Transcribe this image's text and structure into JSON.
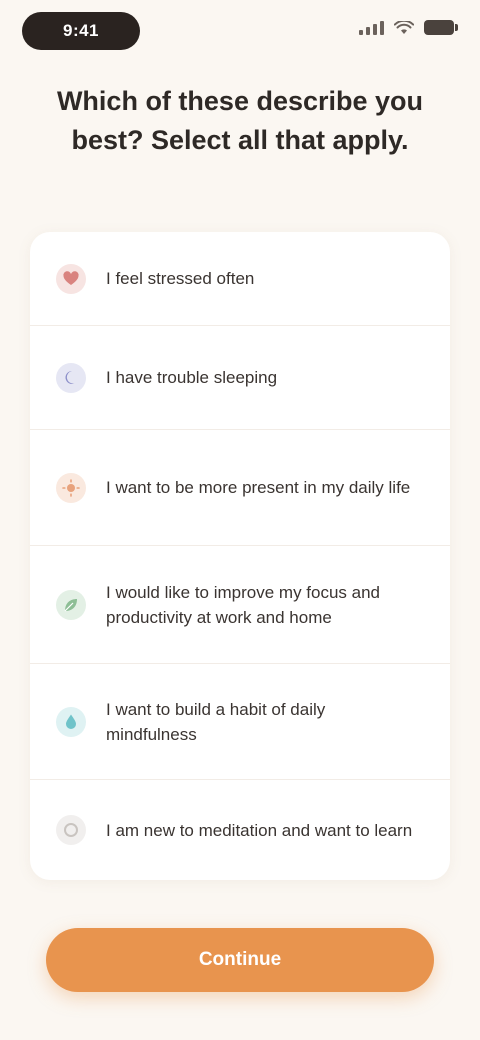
{
  "status_bar": {
    "time": "9:41",
    "icons": [
      "signal-icon",
      "wifi-icon",
      "battery-icon"
    ]
  },
  "header": {
    "title": "Which of these describe you best? Select all that apply."
  },
  "options": [
    {
      "label": "I feel stressed often",
      "icon": "heart-icon",
      "color": "#D9837F"
    },
    {
      "label": "I have trouble sleeping",
      "icon": "moon-icon",
      "color": "#8C8FC9"
    },
    {
      "label": "I want to be more present in my daily life",
      "icon": "sun-icon",
      "color": "#E8A27C"
    },
    {
      "label": "I would like to improve my focus and productivity at work and home",
      "icon": "leaf-icon",
      "color": "#8DBE95"
    },
    {
      "label": "I want to build a habit of daily mindfulness",
      "icon": "drop-icon",
      "color": "#6FC3C9"
    },
    {
      "label": "I am new to meditation and want to learn",
      "icon": "circle-icon",
      "color": "#C9C4C0"
    }
  ],
  "footer": {
    "continue_label": "Continue"
  },
  "colors": {
    "background": "#FBF7F2",
    "accent": "#E8944E",
    "text": "#2E2926"
  }
}
